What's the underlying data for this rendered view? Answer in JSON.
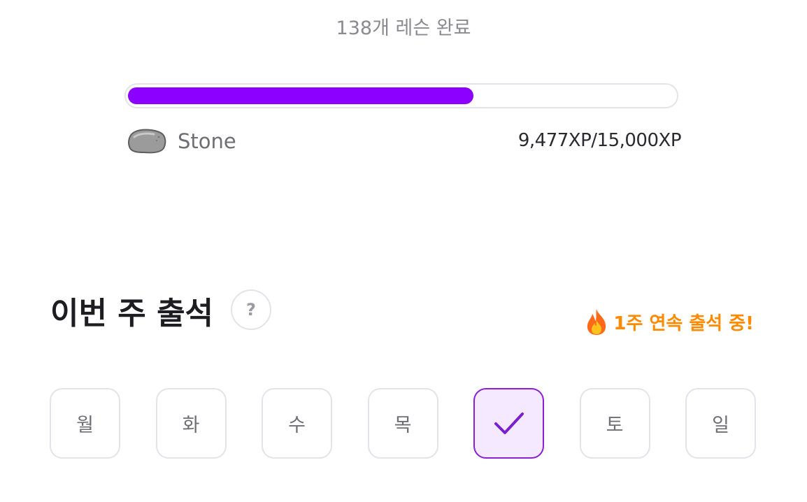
{
  "progress": {
    "lessons_completed_text": "138개 레슨 완료",
    "fraction": 0.6318,
    "rank_name": "Stone",
    "xp_text": "9,477XP/15,000XP",
    "bar_color": "#8c00ff"
  },
  "attendance": {
    "title": "이번 주 출석",
    "help_label": "?",
    "streak_text": "1주 연속 출석 중!",
    "streak_color": "#ff8a00",
    "days": [
      {
        "label": "월",
        "checked": false
      },
      {
        "label": "화",
        "checked": false
      },
      {
        "label": "수",
        "checked": false
      },
      {
        "label": "목",
        "checked": false
      },
      {
        "label": "",
        "checked": true,
        "icon": "check-icon"
      },
      {
        "label": "토",
        "checked": false
      },
      {
        "label": "일",
        "checked": false
      }
    ]
  }
}
